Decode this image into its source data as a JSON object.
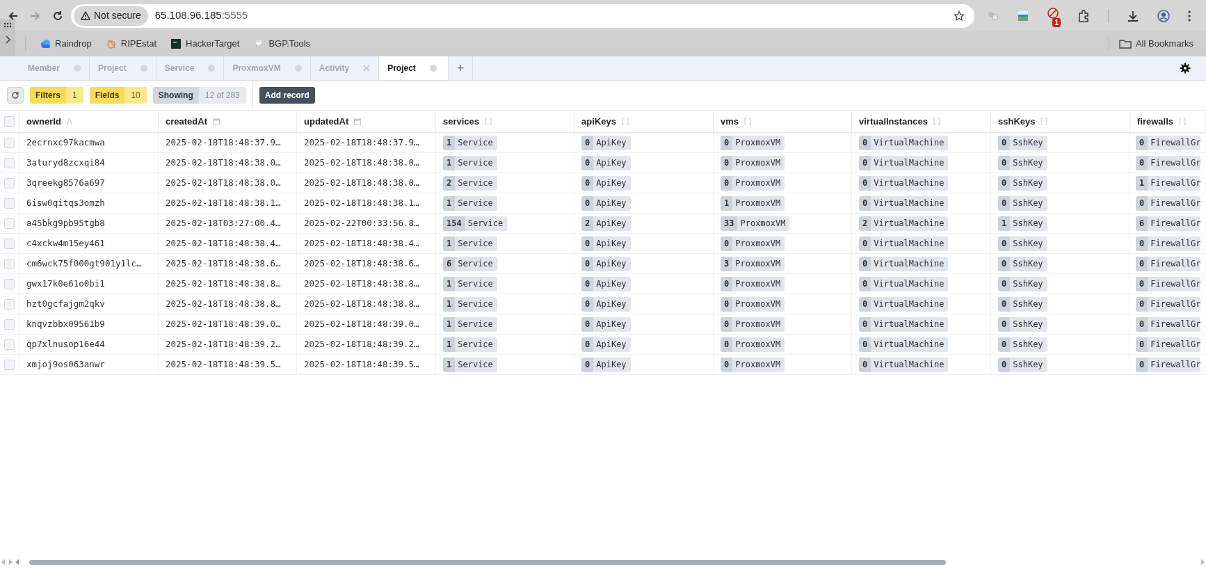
{
  "browser": {
    "security_label": "Not secure",
    "url_host": "65.108.96.185",
    "url_port": ":5555",
    "extension_badge": "1",
    "bookmarks": [
      {
        "label": "Raindrop",
        "kind": "cloud"
      },
      {
        "label": "RIPEstat",
        "kind": "swirl"
      },
      {
        "label": "HackerTarget",
        "kind": "square"
      },
      {
        "label": "BGP.Tools",
        "kind": "face"
      }
    ],
    "all_bookmarks": "All Bookmarks"
  },
  "tabs": [
    {
      "label": "Member",
      "selected": false,
      "closable": false
    },
    {
      "label": "Project",
      "selected": false,
      "closable": false
    },
    {
      "label": "Service",
      "selected": false,
      "closable": false
    },
    {
      "label": "ProxmoxVM",
      "selected": false,
      "closable": false
    },
    {
      "label": "Activity",
      "selected": false,
      "closable": true
    },
    {
      "label": "Project",
      "selected": true,
      "closable": false
    }
  ],
  "new_tab": "+",
  "toolbar": {
    "filters": {
      "label": "Filters",
      "count": "1"
    },
    "fields": {
      "label": "Fields",
      "count": "10"
    },
    "showing": {
      "label": "Showing",
      "value": "12 of 283"
    },
    "add_button": "Add record"
  },
  "table": {
    "all_checked": false,
    "columns": [
      {
        "name": "ownerId",
        "kind": "text",
        "type_mark": "A"
      },
      {
        "name": "createdAt",
        "kind": "date"
      },
      {
        "name": "updatedAt",
        "kind": "date"
      },
      {
        "name": "services",
        "kind": "list"
      },
      {
        "name": "apiKeys",
        "kind": "list"
      },
      {
        "name": "vms",
        "kind": "list"
      },
      {
        "name": "virtualInstances",
        "kind": "list"
      },
      {
        "name": "sshKeys",
        "kind": "list"
      },
      {
        "name": "firewalls",
        "kind": "list"
      }
    ],
    "rows": [
      {
        "checked": false,
        "ownerId": "2ecrnxc97kacmwa",
        "createdAt": "2025-02-18T18:48:37.9…",
        "updatedAt": "2025-02-18T18:48:37.9…",
        "links": [
          {
            "count": "1",
            "label": "Service"
          },
          {
            "count": "0",
            "label": "ApiKey"
          },
          {
            "count": "0",
            "label": "ProxmoxVM"
          },
          {
            "count": "0",
            "label": "VirtualMachine"
          },
          {
            "count": "0",
            "label": "SshKey"
          },
          {
            "count": "0",
            "label": "FirewallGr"
          }
        ]
      },
      {
        "checked": false,
        "ownerId": "3aturyd8zcxqi84",
        "createdAt": "2025-02-18T18:48:38.0…",
        "updatedAt": "2025-02-18T18:48:38.0…",
        "links": [
          {
            "count": "1",
            "label": "Service"
          },
          {
            "count": "0",
            "label": "ApiKey"
          },
          {
            "count": "0",
            "label": "ProxmoxVM"
          },
          {
            "count": "0",
            "label": "VirtualMachine"
          },
          {
            "count": "0",
            "label": "SshKey"
          },
          {
            "count": "0",
            "label": "FirewallGr"
          }
        ]
      },
      {
        "checked": false,
        "ownerId": "3qreekg8576a697",
        "createdAt": "2025-02-18T18:48:38.0…",
        "updatedAt": "2025-02-18T18:48:38.0…",
        "links": [
          {
            "count": "2",
            "label": "Service"
          },
          {
            "count": "0",
            "label": "ApiKey"
          },
          {
            "count": "0",
            "label": "ProxmoxVM"
          },
          {
            "count": "0",
            "label": "VirtualMachine"
          },
          {
            "count": "0",
            "label": "SshKey"
          },
          {
            "count": "1",
            "label": "FirewallGr"
          }
        ]
      },
      {
        "checked": false,
        "ownerId": "6isw0qitqs3omzh",
        "createdAt": "2025-02-18T18:48:38.1…",
        "updatedAt": "2025-02-18T18:48:38.1…",
        "links": [
          {
            "count": "1",
            "label": "Service"
          },
          {
            "count": "0",
            "label": "ApiKey"
          },
          {
            "count": "1",
            "label": "ProxmoxVM"
          },
          {
            "count": "0",
            "label": "VirtualMachine"
          },
          {
            "count": "0",
            "label": "SshKey"
          },
          {
            "count": "0",
            "label": "FirewallGr"
          }
        ]
      },
      {
        "checked": false,
        "ownerId": "a45bkg9pb95tgb8",
        "createdAt": "2025-02-18T03:27:00.4…",
        "updatedAt": "2025-02-22T00:33:56.8…",
        "links": [
          {
            "count": "154",
            "label": "Service"
          },
          {
            "count": "2",
            "label": "ApiKey"
          },
          {
            "count": "33",
            "label": "ProxmoxVM"
          },
          {
            "count": "2",
            "label": "VirtualMachine"
          },
          {
            "count": "1",
            "label": "SshKey"
          },
          {
            "count": "6",
            "label": "FirewallGr"
          }
        ]
      },
      {
        "checked": false,
        "ownerId": "c4xckw4m15ey461",
        "createdAt": "2025-02-18T18:48:38.4…",
        "updatedAt": "2025-02-18T18:48:38.4…",
        "links": [
          {
            "count": "1",
            "label": "Service"
          },
          {
            "count": "0",
            "label": "ApiKey"
          },
          {
            "count": "0",
            "label": "ProxmoxVM"
          },
          {
            "count": "0",
            "label": "VirtualMachine"
          },
          {
            "count": "0",
            "label": "SshKey"
          },
          {
            "count": "0",
            "label": "FirewallGr"
          }
        ]
      },
      {
        "checked": false,
        "ownerId": "cm6wck75f000gt901y1lc…",
        "createdAt": "2025-02-18T18:48:38.6…",
        "updatedAt": "2025-02-18T18:48:38.6…",
        "links": [
          {
            "count": "6",
            "label": "Service"
          },
          {
            "count": "0",
            "label": "ApiKey"
          },
          {
            "count": "3",
            "label": "ProxmoxVM"
          },
          {
            "count": "0",
            "label": "VirtualMachine"
          },
          {
            "count": "0",
            "label": "SshKey"
          },
          {
            "count": "0",
            "label": "FirewallGr"
          }
        ]
      },
      {
        "checked": false,
        "ownerId": "gwx17k0e61o0bi1",
        "createdAt": "2025-02-18T18:48:38.8…",
        "updatedAt": "2025-02-18T18:48:38.8…",
        "links": [
          {
            "count": "1",
            "label": "Service"
          },
          {
            "count": "0",
            "label": "ApiKey"
          },
          {
            "count": "0",
            "label": "ProxmoxVM"
          },
          {
            "count": "0",
            "label": "VirtualMachine"
          },
          {
            "count": "0",
            "label": "SshKey"
          },
          {
            "count": "0",
            "label": "FirewallGr"
          }
        ]
      },
      {
        "checked": false,
        "ownerId": "hzt0gcfajgm2qkv",
        "createdAt": "2025-02-18T18:48:38.8…",
        "updatedAt": "2025-02-18T18:48:38.8…",
        "links": [
          {
            "count": "1",
            "label": "Service"
          },
          {
            "count": "0",
            "label": "ApiKey"
          },
          {
            "count": "0",
            "label": "ProxmoxVM"
          },
          {
            "count": "0",
            "label": "VirtualMachine"
          },
          {
            "count": "0",
            "label": "SshKey"
          },
          {
            "count": "0",
            "label": "FirewallGr"
          }
        ]
      },
      {
        "checked": false,
        "ownerId": "knqvzbbx09561b9",
        "createdAt": "2025-02-18T18:48:39.0…",
        "updatedAt": "2025-02-18T18:48:39.0…",
        "links": [
          {
            "count": "1",
            "label": "Service"
          },
          {
            "count": "0",
            "label": "ApiKey"
          },
          {
            "count": "0",
            "label": "ProxmoxVM"
          },
          {
            "count": "0",
            "label": "VirtualMachine"
          },
          {
            "count": "0",
            "label": "SshKey"
          },
          {
            "count": "0",
            "label": "FirewallGr"
          }
        ]
      },
      {
        "checked": false,
        "ownerId": "qp7xlnusop16e44",
        "createdAt": "2025-02-18T18:48:39.2…",
        "updatedAt": "2025-02-18T18:48:39.2…",
        "links": [
          {
            "count": "1",
            "label": "Service"
          },
          {
            "count": "0",
            "label": "ApiKey"
          },
          {
            "count": "0",
            "label": "ProxmoxVM"
          },
          {
            "count": "0",
            "label": "VirtualMachine"
          },
          {
            "count": "0",
            "label": "SshKey"
          },
          {
            "count": "0",
            "label": "FirewallGr"
          }
        ]
      },
      {
        "checked": false,
        "ownerId": "xmjoj9os063anwr",
        "createdAt": "2025-02-18T18:48:39.5…",
        "updatedAt": "2025-02-18T18:48:39.5…",
        "links": [
          {
            "count": "1",
            "label": "Service"
          },
          {
            "count": "0",
            "label": "ApiKey"
          },
          {
            "count": "0",
            "label": "ProxmoxVM"
          },
          {
            "count": "0",
            "label": "VirtualMachine"
          },
          {
            "count": "0",
            "label": "SshKey"
          },
          {
            "count": "0",
            "label": "FirewallGr"
          }
        ]
      }
    ]
  }
}
